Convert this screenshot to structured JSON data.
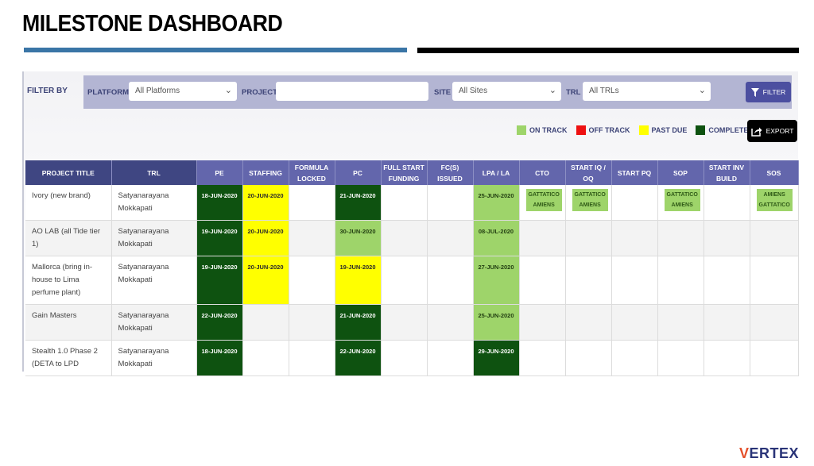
{
  "header": {
    "title": "MILESTONE DASHBOARD"
  },
  "filters": {
    "label": "FILTER BY",
    "platform": {
      "label": "PLATFORM",
      "value": "All Platforms"
    },
    "project": {
      "label": "PROJECT",
      "value": "",
      "placeholder": ""
    },
    "site": {
      "label": "SITE",
      "value": "All Sites"
    },
    "trl": {
      "label": "TRL",
      "value": "All TRLs"
    },
    "filter_button": "FILTER"
  },
  "legend": [
    {
      "label": "ON TRACK",
      "color": "#9ed46a"
    },
    {
      "label": "OFF TRACK",
      "color": "#ee1111"
    },
    {
      "label": "PAST DUE",
      "color": "#ffff00"
    },
    {
      "label": "COMPLETED",
      "color": "#0e5210"
    }
  ],
  "export_button": "EXPORT",
  "table": {
    "columns": [
      "PROJECT TITLE",
      "TRL",
      "PE",
      "STAFFING",
      "FORMULA LOCKED",
      "PC",
      "FULL START FUNDING",
      "FC(S) ISSUED",
      "LPA / LA",
      "CTO",
      "START IQ / OQ",
      "START PQ",
      "SOP",
      "START INV BUILD",
      "SOS"
    ],
    "rows": [
      {
        "project": "Ivory (new brand)",
        "trl": "Satyanarayana Mokkapati",
        "pe": {
          "value": "18-JUN-2020",
          "status": "completed"
        },
        "staffing": {
          "value": "20-JUN-2020",
          "status": "pastdue"
        },
        "formula_locked": {
          "value": "",
          "status": ""
        },
        "pc": {
          "value": "21-JUN-2020",
          "status": "completed"
        },
        "full_start_funding": {
          "value": "",
          "status": ""
        },
        "fcs_issued": {
          "value": "",
          "status": ""
        },
        "lpa_la": {
          "value": "25-JUN-2020",
          "status": "ontrack"
        },
        "cto": [
          "GATTATICO",
          "AMIENS"
        ],
        "start_iq_oq": [
          "GATTATICO",
          "AMIENS"
        ],
        "start_pq": [],
        "sop": [
          "GATTATICO",
          "AMIENS"
        ],
        "start_inv_build": [],
        "sos": [
          "AMIENS",
          "GATTATICO"
        ]
      },
      {
        "project": "AO LAB (all Tide tier 1)",
        "trl": "Satyanarayana Mokkapati",
        "pe": {
          "value": "19-JUN-2020",
          "status": "completed"
        },
        "staffing": {
          "value": "20-JUN-2020",
          "status": "pastdue"
        },
        "formula_locked": {
          "value": "",
          "status": ""
        },
        "pc": {
          "value": "30-JUN-2020",
          "status": "ontrack"
        },
        "full_start_funding": {
          "value": "",
          "status": ""
        },
        "fcs_issued": {
          "value": "",
          "status": ""
        },
        "lpa_la": {
          "value": "08-JUL-2020",
          "status": "ontrack"
        },
        "cto": [],
        "start_iq_oq": [],
        "start_pq": [],
        "sop": [],
        "start_inv_build": [],
        "sos": []
      },
      {
        "project": "Mallorca (bring in-house to Lima perfume plant)",
        "trl": "Satyanarayana Mokkapati",
        "pe": {
          "value": "19-JUN-2020",
          "status": "completed"
        },
        "staffing": {
          "value": "20-JUN-2020",
          "status": "pastdue"
        },
        "formula_locked": {
          "value": "",
          "status": ""
        },
        "pc": {
          "value": "19-JUN-2020",
          "status": "pastdue"
        },
        "full_start_funding": {
          "value": "",
          "status": ""
        },
        "fcs_issued": {
          "value": "",
          "status": ""
        },
        "lpa_la": {
          "value": "27-JUN-2020",
          "status": "ontrack"
        },
        "cto": [],
        "start_iq_oq": [],
        "start_pq": [],
        "sop": [],
        "start_inv_build": [],
        "sos": []
      },
      {
        "project": "Gain Masters",
        "trl": "Satyanarayana Mokkapati",
        "pe": {
          "value": "22-JUN-2020",
          "status": "completed"
        },
        "staffing": {
          "value": "",
          "status": ""
        },
        "formula_locked": {
          "value": "",
          "status": ""
        },
        "pc": {
          "value": "21-JUN-2020",
          "status": "completed"
        },
        "full_start_funding": {
          "value": "",
          "status": ""
        },
        "fcs_issued": {
          "value": "",
          "status": ""
        },
        "lpa_la": {
          "value": "25-JUN-2020",
          "status": "ontrack"
        },
        "cto": [],
        "start_iq_oq": [],
        "start_pq": [],
        "sop": [],
        "start_inv_build": [],
        "sos": []
      },
      {
        "project": "Stealth 1.0 Phase 2 (DETA to LPD",
        "trl": "Satyanarayana Mokkapati",
        "pe": {
          "value": "18-JUN-2020",
          "status": "completed"
        },
        "staffing": {
          "value": "",
          "status": ""
        },
        "formula_locked": {
          "value": "",
          "status": ""
        },
        "pc": {
          "value": "22-JUN-2020",
          "status": "completed"
        },
        "full_start_funding": {
          "value": "",
          "status": ""
        },
        "fcs_issued": {
          "value": "",
          "status": ""
        },
        "lpa_la": {
          "value": "29-JUN-2020",
          "status": "completed"
        },
        "cto": [],
        "start_iq_oq": [],
        "start_pq": [],
        "sop": [],
        "start_inv_build": [],
        "sos": []
      }
    ]
  },
  "logo": {
    "first": "V",
    "rest": "ERTEX"
  }
}
